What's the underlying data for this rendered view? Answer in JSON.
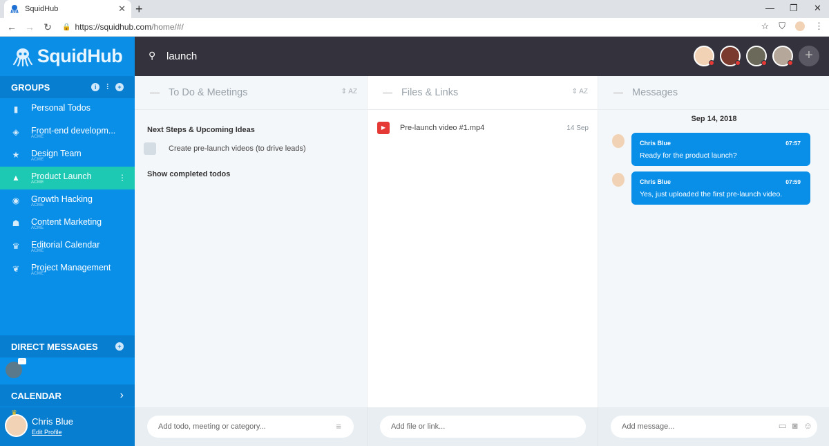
{
  "browser": {
    "tab_title": "SquidHub",
    "url_host": "https://squidhub.com",
    "url_path": "/home/#/"
  },
  "app": {
    "logo": "SquidHub",
    "search_value": "launch"
  },
  "sidebar": {
    "groups_label": "GROUPS",
    "groups": [
      {
        "name": "Personal Todos",
        "sub": "",
        "icon": "book-icon"
      },
      {
        "name": "Front-end developm...",
        "sub": "ACME",
        "icon": "layers-icon"
      },
      {
        "name": "Design Team",
        "sub": "ACME",
        "icon": "star-icon"
      },
      {
        "name": "Product Launch",
        "sub": "ACME",
        "icon": "rocket-icon",
        "active": true
      },
      {
        "name": "Growth Hacking",
        "sub": "ACME",
        "icon": "compass-icon"
      },
      {
        "name": "Content Marketing",
        "sub": "ACME",
        "icon": "ghost-icon"
      },
      {
        "name": "Editorial Calendar",
        "sub": "ACME",
        "icon": "trophy-icon"
      },
      {
        "name": "Project Management",
        "sub": "ACME",
        "icon": "leaf-icon"
      }
    ],
    "dm_label": "DIRECT MESSAGES",
    "calendar_label": "CALENDAR",
    "profile_name": "Chris Blue",
    "profile_edit": "Edit Profile"
  },
  "todos": {
    "title": "To Do & Meetings",
    "sort": "AZ",
    "category": "Next Steps & Upcoming Ideas",
    "items": [
      "Create pre-launch videos (to drive leads)"
    ],
    "show_completed": "Show completed todos",
    "input_placeholder": "Add todo, meeting or category..."
  },
  "files": {
    "title": "Files & Links",
    "sort": "AZ",
    "items": [
      {
        "name": "Pre-launch video #1.mp4",
        "date": "14 Sep"
      }
    ],
    "input_placeholder": "Add file or link..."
  },
  "messages": {
    "title": "Messages",
    "date": "Sep 14, 2018",
    "items": [
      {
        "name": "Chris Blue",
        "time": "07:57",
        "text": "Ready for the product launch?"
      },
      {
        "name": "Chris Blue",
        "time": "07:59",
        "text": "Yes, just uploaded the first pre-launch video."
      }
    ],
    "input_placeholder": "Add message..."
  },
  "colors": {
    "brand_blue": "#0a8fe8",
    "active_green": "#1ec9b4",
    "topbar_dark": "#33323d",
    "status_red": "#e53935"
  }
}
